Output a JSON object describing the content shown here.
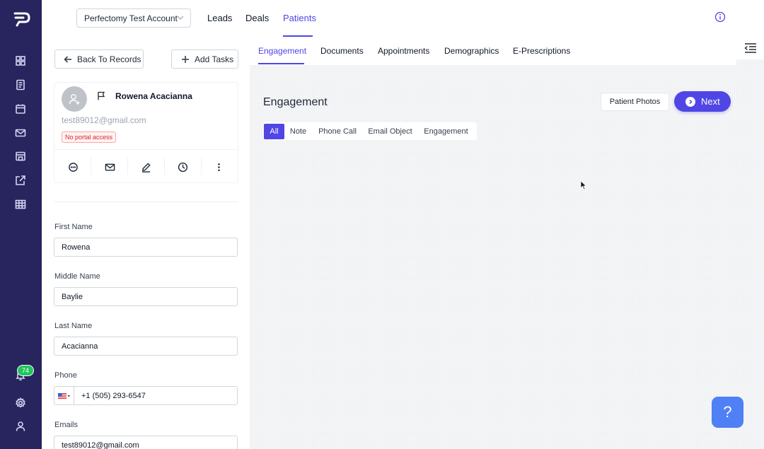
{
  "topbar": {
    "account": "Perfectomy Test Account",
    "tabs": [
      "Leads",
      "Deals",
      "Patients"
    ],
    "active_tab": "Patients"
  },
  "sidebar": {
    "notification_count": "74"
  },
  "left_panel": {
    "back_label": "Back To Records",
    "add_tasks_label": "Add Tasks",
    "patient_name": "Rowena Acacianna",
    "patient_email": "test89012@gmail.com",
    "portal_badge": "No portal access",
    "fields": {
      "first_name_label": "First Name",
      "first_name": "Rowena",
      "middle_name_label": "Middle Name",
      "middle_name": "Baylie",
      "last_name_label": "Last Name",
      "last_name": "Acacianna",
      "phone_label": "Phone",
      "phone": "+1 (505) 293-6547",
      "emails_label": "Emails",
      "email": "test89012@gmail.com"
    }
  },
  "main": {
    "tabs": [
      "Engagement",
      "Documents",
      "Appointments",
      "Demographics",
      "E-Prescriptions"
    ],
    "active_tab": "Engagement",
    "section_title": "Engagement",
    "patient_photos_label": "Patient Photos",
    "next_label": "Next",
    "filters": [
      "All",
      "Note",
      "Phone Call",
      "Email Object",
      "Engagement"
    ],
    "active_filter": "All",
    "help_label": "?"
  },
  "colors": {
    "sidebar": "#27245e",
    "accent": "#4f46e5",
    "help": "#4f80f5",
    "badge_green": "#22c55e"
  }
}
